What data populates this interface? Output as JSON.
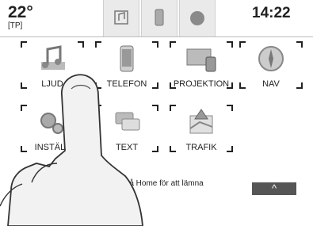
{
  "status": {
    "temperature": "22°",
    "source_tag": "[TP]",
    "clock": "14:22",
    "buttons": [
      {
        "name": "music-icon"
      },
      {
        "name": "phone-icon"
      },
      {
        "name": "record-icon"
      }
    ]
  },
  "apps": [
    {
      "id": "ljud",
      "label": "LJUD",
      "icon": "music-note-icon"
    },
    {
      "id": "telefon",
      "label": "TELEFON",
      "icon": "smartphone-icon"
    },
    {
      "id": "projektion",
      "label": "PROJEKTION",
      "icon": "projection-icon"
    },
    {
      "id": "nav",
      "label": "NAV",
      "icon": "compass-icon"
    },
    {
      "id": "installningar",
      "label": "INSTÄLL",
      "icon": "gears-icon"
    },
    {
      "id": "text",
      "label": "TEXT",
      "icon": "chat-bubbles-icon"
    },
    {
      "id": "trafik",
      "label": "TRAFIK",
      "icon": "traffic-map-icon"
    }
  ],
  "hint_text": "e: Tryck på Home för att lämna",
  "up_button_label": "^"
}
